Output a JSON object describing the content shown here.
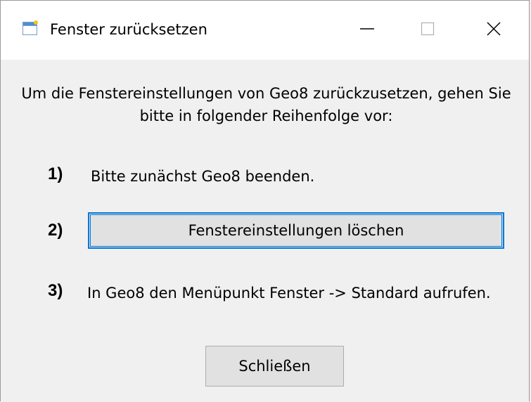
{
  "window": {
    "title": "Fenster zurücksetzen",
    "icon": "window-app-icon"
  },
  "caption_buttons": {
    "minimize_icon": "minimize-icon",
    "maximize_icon": "maximize-icon",
    "close_icon": "close-icon"
  },
  "intro": {
    "line1": "Um die Fenstereinstellungen von Geo8 zurückzusetzen, gehen Sie",
    "line2": "bitte in folgender Reihenfolge vor:"
  },
  "steps": [
    {
      "number": "1)",
      "text": "Bitte zunächst Geo8 beenden."
    },
    {
      "number": "2)",
      "button_label": "Fenstereinstellungen löschen"
    },
    {
      "number": "3)",
      "text": "In Geo8 den Menüpunkt Fenster -> Standard aufrufen."
    }
  ],
  "footer": {
    "close_label": "Schließen"
  },
  "colors": {
    "accent": "#0078d7",
    "button_face": "#e1e1e1",
    "dialog_bg": "#f0f0f0",
    "titlebar_bg": "#ffffff"
  }
}
